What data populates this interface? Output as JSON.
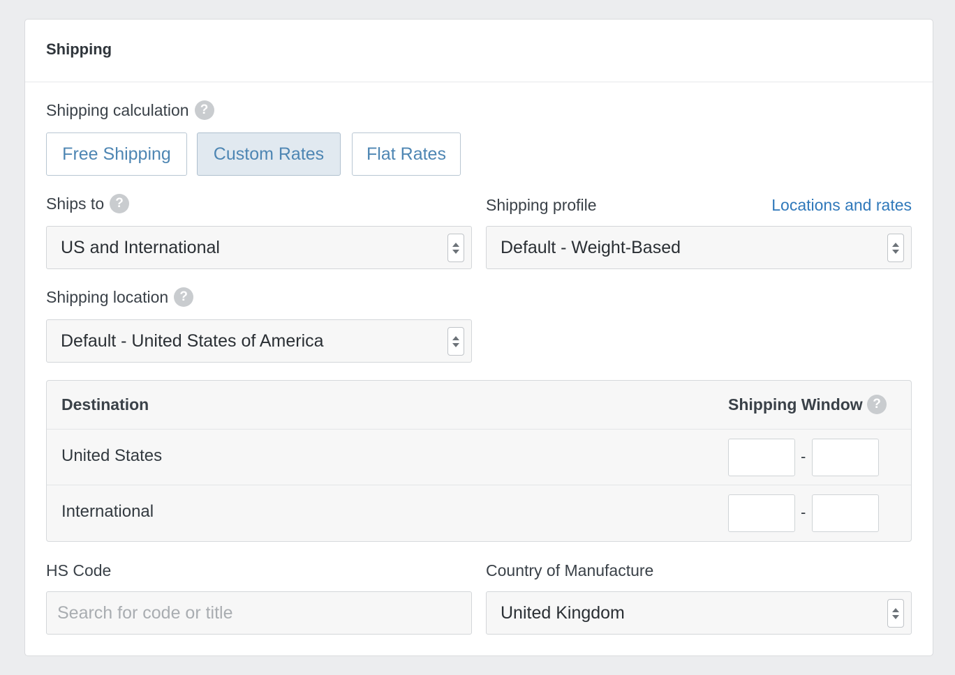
{
  "card": {
    "title": "Shipping"
  },
  "calculation": {
    "label": "Shipping calculation",
    "help_glyph": "?",
    "options": [
      {
        "label": "Free Shipping",
        "active": false
      },
      {
        "label": "Custom Rates",
        "active": true
      },
      {
        "label": "Flat Rates",
        "active": false
      }
    ]
  },
  "ships_to": {
    "label": "Ships to",
    "help_glyph": "?",
    "value": "US and International"
  },
  "shipping_profile": {
    "label": "Shipping profile",
    "link": "Locations and rates",
    "value": "Default - Weight-Based"
  },
  "shipping_location": {
    "label": "Shipping location",
    "help_glyph": "?",
    "value": "Default - United States of America"
  },
  "window_table": {
    "headers": {
      "destination": "Destination",
      "window": "Shipping Window",
      "help_glyph": "?"
    },
    "rows": [
      {
        "destination": "United States",
        "min": "",
        "max": "",
        "separator": "-"
      },
      {
        "destination": "International",
        "min": "",
        "max": "",
        "separator": "-"
      }
    ]
  },
  "hs_code": {
    "label": "HS Code",
    "placeholder": "Search for code or title",
    "value": ""
  },
  "country_of_manufacture": {
    "label": "Country of Manufacture",
    "value": "United Kingdom"
  },
  "icons": {
    "help": "question-circle-icon",
    "select": "up-down-stepper-icon"
  },
  "colors": {
    "accent": "#4e86b3",
    "link": "#2f78ba",
    "active_bg": "#e1e9f0",
    "page_bg": "#ecedef"
  }
}
